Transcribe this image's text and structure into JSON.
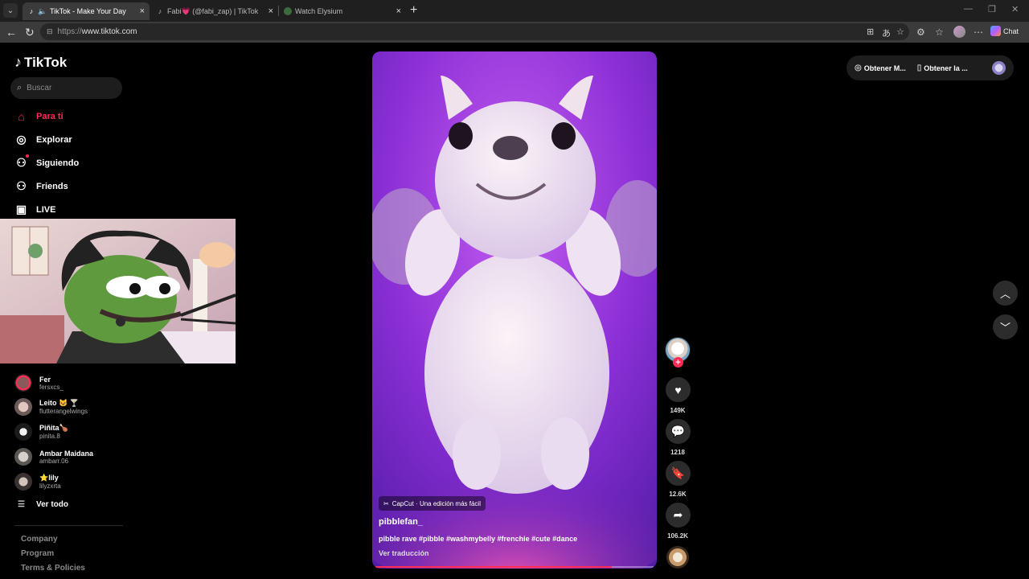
{
  "browser": {
    "tabs": [
      {
        "title": "TikTok - Make Your Day",
        "favicon": "tiktok-icon",
        "active": true
      },
      {
        "title": "Fabi💗 (@fabi_zap) | TikTok",
        "favicon": "tiktok-icon",
        "active": false
      },
      {
        "title": "Watch Elysium",
        "favicon": "globe-icon",
        "active": false
      }
    ],
    "url_scheme": "https://",
    "url_host": "www.tiktok.com",
    "chat_label": "Chat"
  },
  "app": {
    "logo": "TikTok",
    "search_placeholder": "Buscar",
    "nav": [
      {
        "label": "Para ti",
        "icon": "home-icon",
        "active": true
      },
      {
        "label": "Explorar",
        "icon": "compass-icon",
        "active": false
      },
      {
        "label": "Siguiendo",
        "icon": "following-icon",
        "active": false
      },
      {
        "label": "Friends",
        "icon": "friends-icon",
        "active": false
      },
      {
        "label": "LIVE",
        "icon": "live-icon",
        "active": false
      }
    ],
    "following": [
      {
        "name": "Fer",
        "handle": "fersxcs_"
      },
      {
        "name": "Leito 🐱 🍸",
        "handle": "flutterangelwings"
      },
      {
        "name": "Piñita🍗",
        "handle": "pinita.8"
      },
      {
        "name": "Ambar Maidana",
        "handle": "ambarr.06"
      },
      {
        "name": "⭐lily",
        "handle": "lilyzxrta"
      }
    ],
    "see_all": "Ver todo",
    "footer": [
      "Company",
      "Program",
      "Terms & Policies"
    ]
  },
  "video": {
    "capcut_label": "CapCut · Una edición más fácil",
    "username": "pibblefan_",
    "description": "pibble rave #pibble #washmybelly #frenchie #cute #dance",
    "translate": "Ver traducción",
    "progress": 0.85
  },
  "actions": {
    "likes": "149K",
    "comments": "1218",
    "saves": "12.6K",
    "shares": "106.2K"
  },
  "header": {
    "get_coins": "Obtener M...",
    "get_app": "Obtener la ..."
  },
  "colors": {
    "accent": "#fe2c55",
    "background": "#000000"
  }
}
